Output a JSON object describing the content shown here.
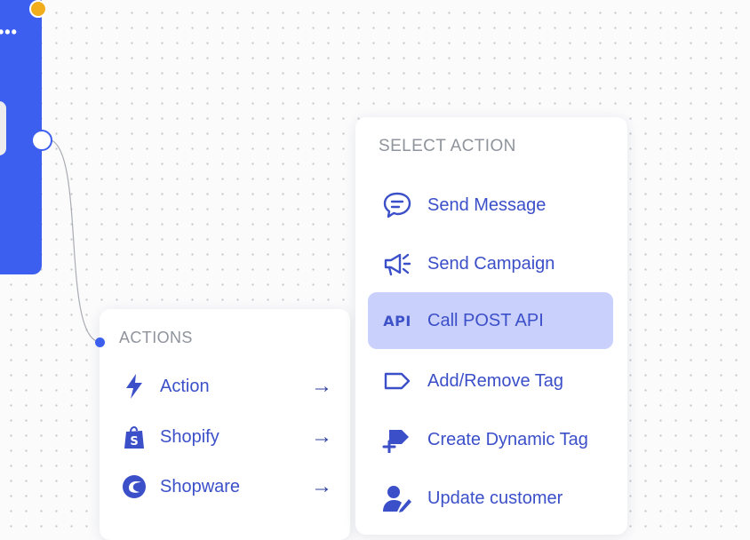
{
  "node": {
    "menu_glyph": "•••"
  },
  "actions_panel": {
    "title": "ACTIONS",
    "items": [
      {
        "label": "Action",
        "icon": "lightning-icon",
        "arrow": "→"
      },
      {
        "label": "Shopify",
        "icon": "shopify-bag-icon",
        "arrow": "→"
      },
      {
        "label": "Shopware",
        "icon": "shopware-logo-icon",
        "arrow": "→"
      }
    ]
  },
  "select_panel": {
    "title": "SELECT ACTION",
    "items": [
      {
        "label": "Send Message",
        "icon": "chat-bubble-icon"
      },
      {
        "label": "Send Campaign",
        "icon": "megaphone-icon"
      },
      {
        "label": "Call POST API",
        "icon": "api-icon",
        "icon_text": "API",
        "selected": true
      },
      {
        "label": "Add/Remove Tag",
        "icon": "tag-icon"
      },
      {
        "label": "Create Dynamic Tag",
        "icon": "dynamic-tag-icon"
      },
      {
        "label": "Update customer",
        "icon": "user-edit-icon"
      }
    ]
  },
  "colors": {
    "accent": "#3d5ff0",
    "item_text": "#3b4fc9",
    "selected_bg": "#c9d0fb",
    "handle_yellow": "#f2ad1c",
    "title_gray": "#8f949c"
  }
}
